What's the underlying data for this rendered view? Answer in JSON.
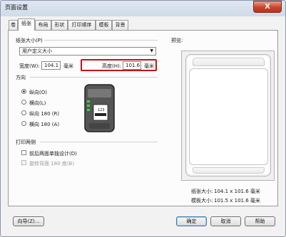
{
  "window": {
    "title": "页面设置",
    "close_label": "X"
  },
  "tabs": [
    {
      "label": "卷"
    },
    {
      "label": "纸张"
    },
    {
      "label": "布局"
    },
    {
      "label": "形状"
    },
    {
      "label": "打印顺序"
    },
    {
      "label": "模板"
    },
    {
      "label": "背景"
    }
  ],
  "paper_size": {
    "section_label": "纸张大小(P)",
    "selected": "用户定义大小",
    "width_label": "宽度(W):",
    "width_value": "104.1",
    "width_unit": "毫米",
    "height_label": "高度(H):",
    "height_value": "101.6",
    "height_unit": "毫米"
  },
  "orientation": {
    "section_label": "方向",
    "options": [
      {
        "label": "纵向(O)",
        "checked": true
      },
      {
        "label": "横向(L)",
        "checked": false
      },
      {
        "label": "纵向 180 (R)",
        "checked": false
      },
      {
        "label": "横向 180 (A)",
        "checked": false
      }
    ],
    "icon_text": "123"
  },
  "duplex": {
    "section_label": "打印两侧",
    "options": [
      {
        "label": "前后两面单独设计(D)",
        "enabled": true
      },
      {
        "label": "旋转背面 180 度(B)",
        "enabled": false
      }
    ]
  },
  "preview": {
    "label": "预览:",
    "paper_size_label": "纸张大小:",
    "paper_size_value": "104.1 x 101.6 毫米",
    "template_size_label": "模板大小:",
    "template_size_value": "101.5 x 101.6 毫米"
  },
  "footer": {
    "wizard_button": "向导(Z)...",
    "ok_button": "确定",
    "cancel_button": "取消",
    "help_button": "帮助"
  }
}
